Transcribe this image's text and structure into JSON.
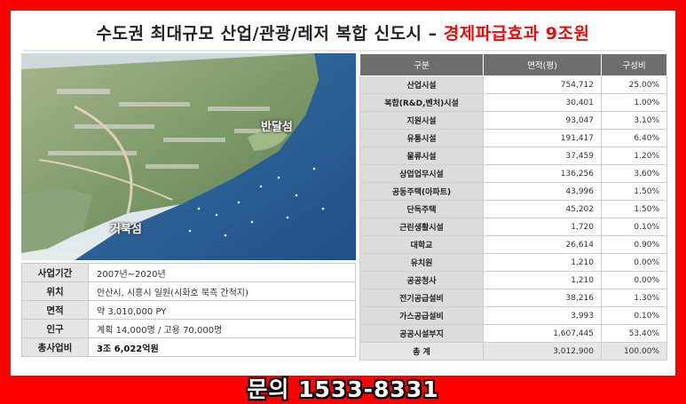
{
  "title": {
    "main": "수도권 최대규모 산업/관광/레저 복합 신도시 –",
    "highlight": "경제파급효과 9조원"
  },
  "aerial": {
    "label_banwol": "반달섬",
    "label_geobuk": "거북섬"
  },
  "info": [
    {
      "key": "사업기간",
      "value": "2007년~2020년"
    },
    {
      "key": "위치",
      "value": "안산시, 시흥시 일원(시화호 북측 간척지)"
    },
    {
      "key": "면적",
      "value": "약 3,010,000 PY"
    },
    {
      "key": "인구",
      "value": "계획 14,000명 / 고용 70,000명"
    },
    {
      "key": "총사업비",
      "value": "3조 6,022억원"
    }
  ],
  "stats": {
    "headers": [
      "구분",
      "면적(평)",
      "구성비"
    ],
    "rows": [
      {
        "name": "산업시설",
        "area": "754,712",
        "ratio": "25.00%"
      },
      {
        "name": "복합(R&D,벤처)시설",
        "area": "30,401",
        "ratio": "1.00%"
      },
      {
        "name": "지원시설",
        "area": "93,047",
        "ratio": "3.10%"
      },
      {
        "name": "유통시설",
        "area": "191,417",
        "ratio": "6.40%"
      },
      {
        "name": "물류시설",
        "area": "37,459",
        "ratio": "1.20%"
      },
      {
        "name": "상업업무시설",
        "area": "136,256",
        "ratio": "3.60%"
      },
      {
        "name": "공동주택(아파트)",
        "area": "43,996",
        "ratio": "1.50%"
      },
      {
        "name": "단독주택",
        "area": "45,202",
        "ratio": "1.50%"
      },
      {
        "name": "근린생활시설",
        "area": "1,720",
        "ratio": "0.10%"
      },
      {
        "name": "대학교",
        "area": "26,614",
        "ratio": "0.90%"
      },
      {
        "name": "유치원",
        "area": "1,210",
        "ratio": "0.00%"
      },
      {
        "name": "공공청사",
        "area": "1,210",
        "ratio": "0.00%"
      },
      {
        "name": "전기공급설비",
        "area": "38,216",
        "ratio": "1.30%"
      },
      {
        "name": "가스공급설비",
        "area": "3,993",
        "ratio": "0.10%"
      },
      {
        "name": "공공시설부지",
        "area": "1,607,445",
        "ratio": "53.40%"
      }
    ],
    "total": {
      "name": "총 계",
      "area": "3,012,900",
      "ratio": "100.00%"
    }
  },
  "contact": "문의 1533-8331",
  "colors": {
    "frame": "#ff0000",
    "highlight": "#e01010",
    "header_bg": "#6e6e6e",
    "label_bg": "#dcdcdc"
  }
}
